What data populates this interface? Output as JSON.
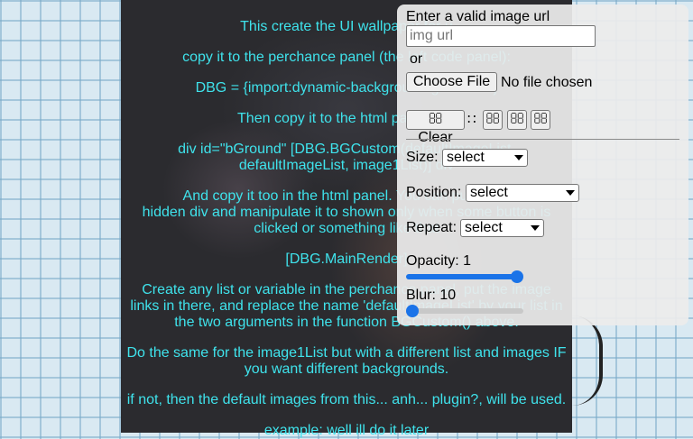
{
  "instructions": [
    "This create the UI wallpaper for u",
    "copy it to the perchance panel (the left code panel):",
    "DBG = {import:dynamic-background-generator}",
    "Then copy it to the html panel (the",
    "div id=\"bGround\" [DBG.BGCustom(defaultImageList,",
    "defaultImageList, image1List)] div",
    "And copy it too in the html panel. You can put it in a",
    "hidden div and manipulate it to shown only when some button is",
    "clicked or something like that",
    "[DBG.MainRender]",
    "Create any list or variable in the perchance panel, put the image",
    "links in there, and replace the name 'defaultImageList' by your list in",
    "the two arguments in the function BGCustom() above.",
    "Do the same for the image1List but with a different list and images IF",
    "you want different backgrounds.",
    "if not, then the default images from this... anh... plugin?, will be used.",
    "example: well ill do it later"
  ],
  "panel": {
    "url_label": "Enter a valid image url",
    "url_placeholder": "img url",
    "or_label": "or",
    "choose_file_label": "Choose File",
    "no_file_label": "No file chosen",
    "clear_label": "Clear",
    "clear_icon": "",
    "grid_icon": "∷",
    "btn1_icon": "",
    "btn2_icon": "",
    "btn3_icon": "",
    "size_label": "Size:",
    "size_value": "select",
    "position_label": "Position:",
    "position_value": "select",
    "repeat_label": "Repeat:",
    "repeat_value": "select",
    "opacity_label": "Opacity: 1",
    "opacity_fraction": 1,
    "blur_label": "Blur: 10",
    "blur_fraction": 0
  },
  "colors": {
    "instruction_text": "#3fe3ec",
    "slider_accent": "#1a73e8"
  }
}
